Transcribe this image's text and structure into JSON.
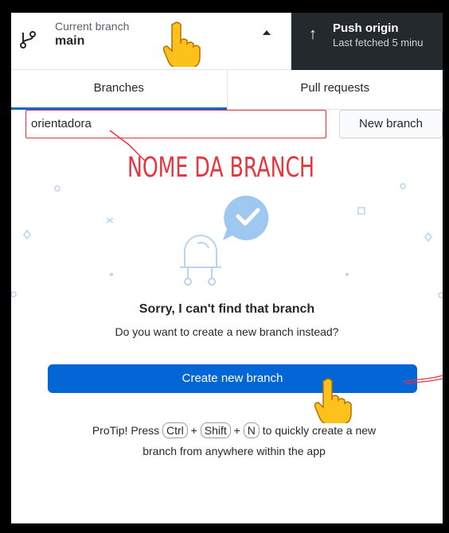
{
  "toolbar": {
    "branch_caption": "Current branch",
    "branch_name": "main",
    "push_title": "Push origin",
    "push_subtitle": "Last fetched 5 minu"
  },
  "tabs": [
    {
      "label": "Branches",
      "active": true
    },
    {
      "label": "Pull requests",
      "active": false
    }
  ],
  "filter": {
    "value": "orientadora"
  },
  "new_branch_label": "New branch",
  "annotation": "NOME DA BRANCH",
  "empty_state": {
    "title": "Sorry, I can't find that branch",
    "subtitle": "Do you want to create a new branch instead?",
    "create_button": "Create new branch"
  },
  "protip": {
    "prefix": "ProTip! Press",
    "keys": [
      "Ctrl",
      "Shift",
      "N"
    ],
    "plus": "+",
    "suffix_line1": "to quickly create a new",
    "suffix_line2": "branch from anywhere within the app"
  },
  "colors": {
    "accent": "#0366d6",
    "annotation": "#e7343f",
    "toolbar_dark": "#24292e"
  },
  "icons": [
    "git-branch-icon",
    "caret-up-icon",
    "arrow-up-icon",
    "pointing-hand-icon"
  ]
}
